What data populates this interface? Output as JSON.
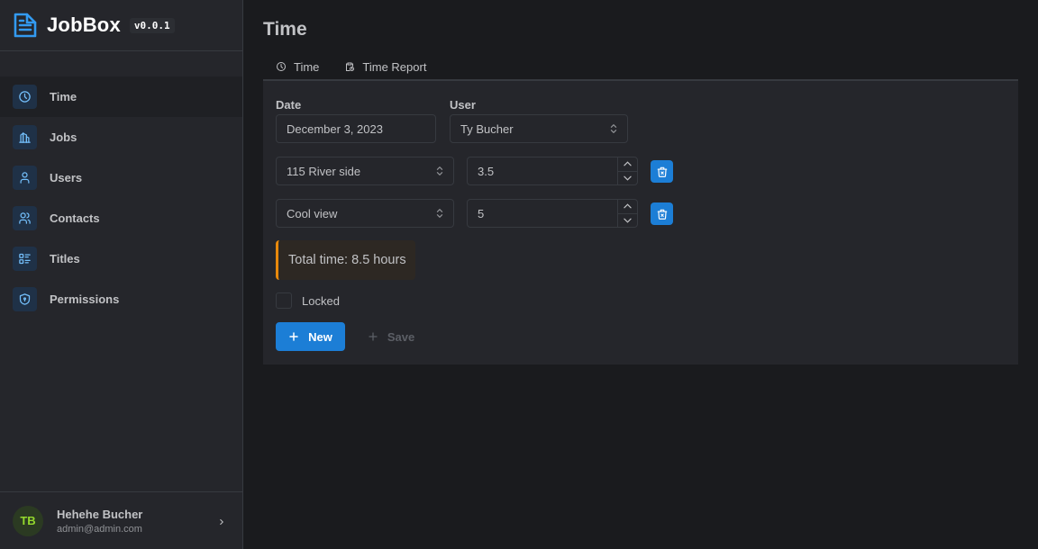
{
  "app": {
    "name": "JobBox",
    "version": "v0.0.1"
  },
  "sidebar": {
    "items": [
      {
        "label": "Time",
        "icon": "clock-icon",
        "active": true
      },
      {
        "label": "Jobs",
        "icon": "building-icon",
        "active": false
      },
      {
        "label": "Users",
        "icon": "user-icon",
        "active": false
      },
      {
        "label": "Contacts",
        "icon": "users-icon",
        "active": false
      },
      {
        "label": "Titles",
        "icon": "list-details-icon",
        "active": false
      },
      {
        "label": "Permissions",
        "icon": "shield-icon",
        "active": false
      }
    ]
  },
  "user": {
    "initials": "TB",
    "name": "Hehehe Bucher",
    "email": "admin@admin.com"
  },
  "page": {
    "title": "Time"
  },
  "tabs": [
    {
      "label": "Time",
      "icon": "clock-icon",
      "active": true
    },
    {
      "label": "Time Report",
      "icon": "report-icon",
      "active": false
    }
  ],
  "form": {
    "date_label": "Date",
    "date_value": "December 3, 2023",
    "user_label": "User",
    "user_value": "Ty Bucher",
    "entries": [
      {
        "job": "115 River side",
        "hours": "3.5"
      },
      {
        "job": "Cool view",
        "hours": "5"
      }
    ],
    "total_text": "Total time: 8.5 hours",
    "locked_label": "Locked",
    "locked": false,
    "new_label": "New",
    "save_label": "Save"
  },
  "colors": {
    "accent": "#1c7ed6",
    "warning": "#e8890c",
    "avatar_text": "#94d82d"
  }
}
